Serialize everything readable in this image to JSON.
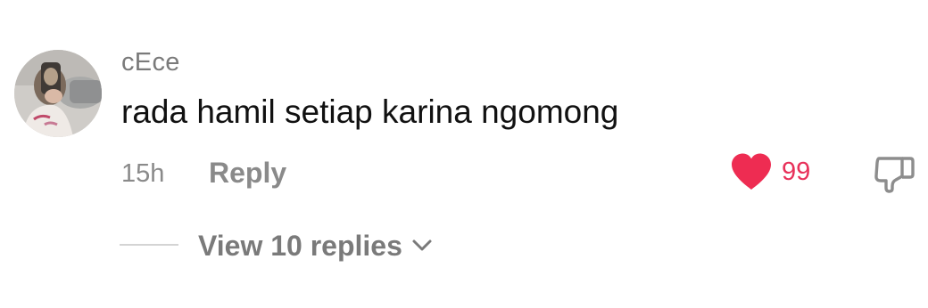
{
  "comment": {
    "username": "cEce",
    "text": "rada hamil setiap karina ngomong",
    "time": "15h",
    "reply_label": "Reply",
    "like_count": "99",
    "liked": true,
    "like_color": "#e8315a"
  },
  "replies": {
    "label": "View 10 replies"
  },
  "icons": {
    "like": "heart-icon",
    "dislike": "thumbs-down-icon",
    "expand": "chevron-down-icon"
  }
}
